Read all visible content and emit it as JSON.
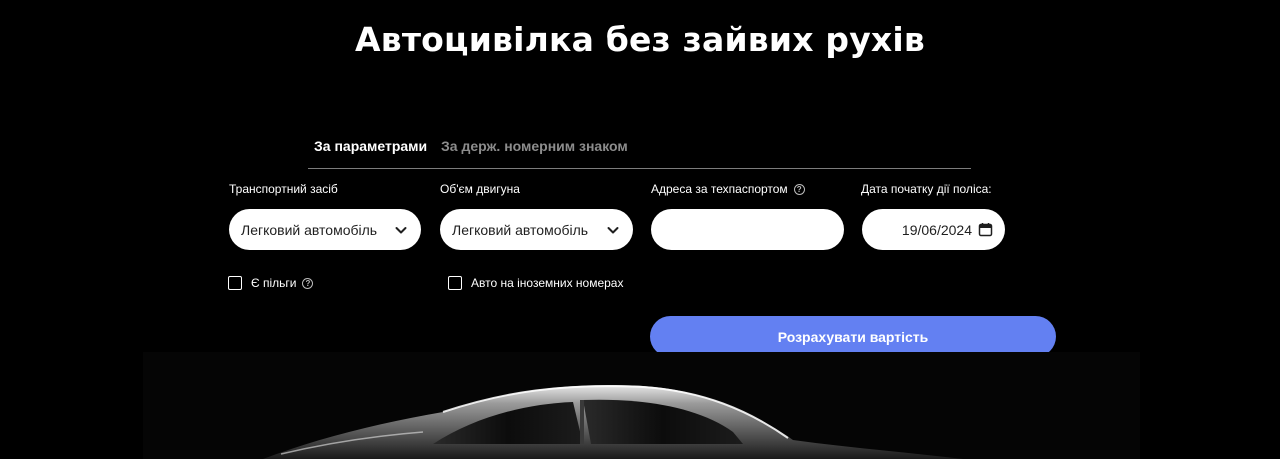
{
  "page": {
    "title": "Автоцивілка без зайвих рухів"
  },
  "tabs": [
    {
      "label": "За параметрами",
      "active": true
    },
    {
      "label": "За держ. номерним знаком",
      "active": false
    }
  ],
  "form": {
    "vehicle": {
      "label": "Транспортний засіб",
      "value": "Легковий автомобіль"
    },
    "engine": {
      "label": "Об'єм двигуна",
      "value": "Легковий автомобіль"
    },
    "address": {
      "label": "Адреса за техпаспортом",
      "value": "",
      "placeholder": ""
    },
    "date": {
      "label": "Дата початку дії поліса:",
      "value": "19/06/2024"
    }
  },
  "checkboxes": {
    "benefits": {
      "label": "Є пільги",
      "checked": false
    },
    "foreign_plates": {
      "label": "Авто на іноземних номерах",
      "checked": false
    }
  },
  "submit_label": "Розрахувати вартість",
  "colors": {
    "accent": "#6380f2",
    "background": "#000000",
    "inactive_tab": "#8c8c8c"
  },
  "icons": [
    "chevron-down-icon",
    "search-icon",
    "calendar-icon",
    "help-icon",
    "car-image"
  ]
}
